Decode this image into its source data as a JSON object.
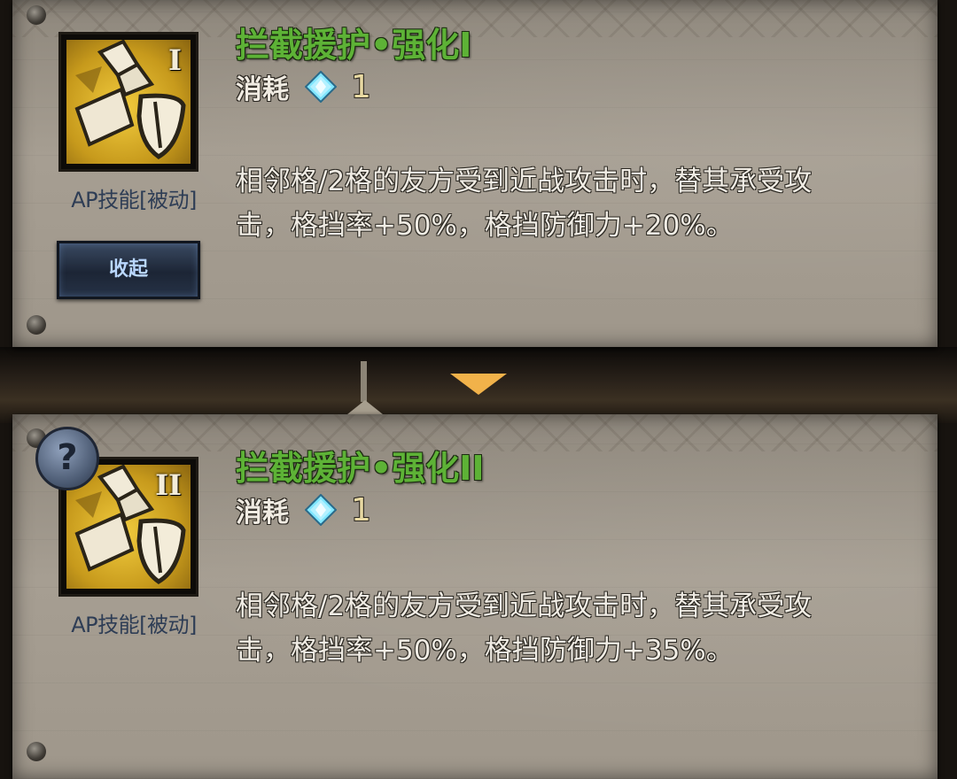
{
  "skills": [
    {
      "title": "拦截援护•强化I",
      "rank": "I",
      "type_label": "AP技能[被动]",
      "cost_label": "消耗",
      "cost_icon": "diamond-gem-icon",
      "cost_value": "1",
      "desc_line1": "相邻格/2格的友方受到近战攻击时，替其承受攻",
      "desc_line2": "击，格挡率+50%，格挡防御力+20%。",
      "button_label": "收起"
    },
    {
      "title": "拦截援护•强化II",
      "rank": "II",
      "type_label": "AP技能[被动]",
      "cost_label": "消耗",
      "cost_icon": "diamond-gem-icon",
      "cost_value": "1",
      "desc_line1": "相邻格/2格的友方受到近战攻击时，替其承受攻",
      "desc_line2": "击，格挡率+50%，格挡防御力+35%。",
      "help_icon_text": "?"
    }
  ],
  "colors": {
    "title_green": "#5db236",
    "label_blue": "#2e3d55",
    "accent_orange": "#f1b24a",
    "gem_cyan": "#7fe6ff"
  }
}
